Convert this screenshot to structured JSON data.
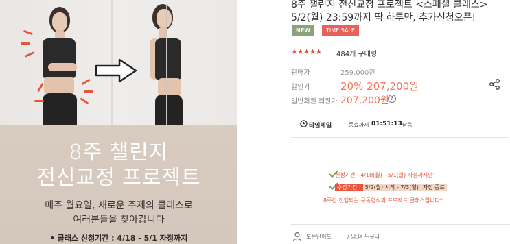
{
  "banner": {
    "headline_line1": "8주 챌린지",
    "headline_line2": "전신교정 프로젝트",
    "desc_line1": "매주 월요일, 새로운 주제의 클래스로",
    "desc_line2": "여러분들을 찾아갑니다",
    "note": "• 클래스 신청기간 : 4/18 - 5/1 자정까지"
  },
  "product": {
    "title_line1": "8주 챌린지 전신교정 프로젝트 <스페셜 클래스>",
    "title_line2": "5/2(월) 23:59까지 딱 하루만, 추가신청오픈!",
    "badges": {
      "new": "NEW",
      "sale": "TIME SALE"
    },
    "rating": {
      "stars": "★★★★★",
      "review_count": "484개 구매평"
    },
    "prices": {
      "list_label": "판매가",
      "list_price": "259,000원",
      "sale_label": "할인가",
      "sale_discount": "20%",
      "sale_price": "207,200원",
      "member_label": "일반회원 회원가",
      "member_price": "207,200원"
    }
  },
  "timer": {
    "label": "타임세일",
    "suffix": "종료까지",
    "value": "01:51:13",
    "end": "남음"
  },
  "schedule": {
    "period": "신청기간 : 4/18(월) - 5/1(일) 자정까지만!",
    "course_label": "수강기간 :",
    "course_range": "5/2(월) 시작 - 7/3(일)",
    "course_end": "자정 종료",
    "note": "8주간 진행되는 구독형식의 프로젝트 클래스입니다*"
  },
  "meta": {
    "level": "모든난이도",
    "target": "/ 남,녀 누구나"
  },
  "colors": {
    "accent": "#e8553a",
    "price": "#f07657",
    "new_badge": "#8aa37c",
    "sale_badge": "#e8625a"
  }
}
